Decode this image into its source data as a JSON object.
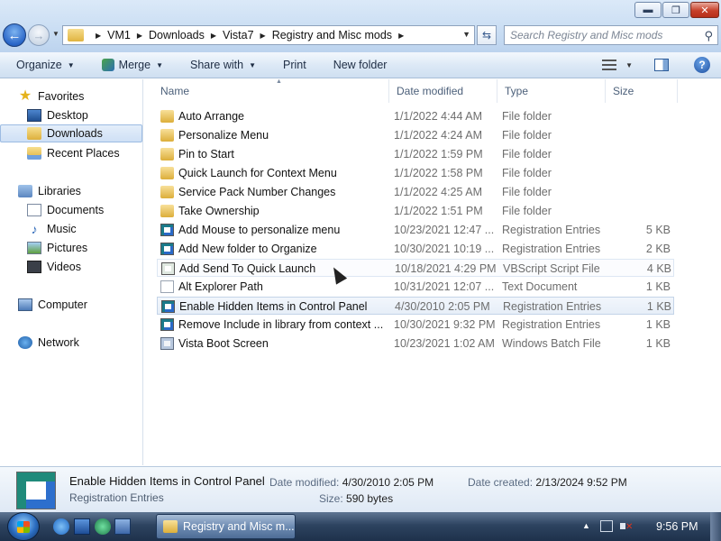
{
  "window": {
    "controls": {
      "minimize": "▬",
      "maximize": "❐",
      "close": "✕"
    },
    "address": {
      "crumbs": [
        "VM1",
        "Downloads",
        "Vista7",
        "Registry and Misc mods"
      ]
    },
    "search": {
      "placeholder": "Search Registry and Misc mods"
    }
  },
  "toolbar": {
    "organize": "Organize",
    "merge": "Merge",
    "share_with": "Share with",
    "print": "Print",
    "new_folder": "New folder"
  },
  "nav": {
    "favorites": "Favorites",
    "desktop": "Desktop",
    "downloads": "Downloads",
    "recent_places": "Recent Places",
    "libraries": "Libraries",
    "documents": "Documents",
    "music": "Music",
    "pictures": "Pictures",
    "videos": "Videos",
    "computer": "Computer",
    "network": "Network"
  },
  "columns": {
    "name": "Name",
    "date_modified": "Date modified",
    "type": "Type",
    "size": "Size"
  },
  "files": [
    {
      "name": "Auto Arrange",
      "date": "1/1/2022 4:44 AM",
      "type": "File folder",
      "size": "",
      "icon": "folder-icon"
    },
    {
      "name": "Personalize Menu",
      "date": "1/1/2022 4:24 AM",
      "type": "File folder",
      "size": "",
      "icon": "folder-icon"
    },
    {
      "name": "Pin to Start",
      "date": "1/1/2022 1:59 PM",
      "type": "File folder",
      "size": "",
      "icon": "folder-icon"
    },
    {
      "name": "Quick Launch for Context Menu",
      "date": "1/1/2022 1:58 PM",
      "type": "File folder",
      "size": "",
      "icon": "folder-icon"
    },
    {
      "name": "Service Pack Number Changes",
      "date": "1/1/2022 4:25 AM",
      "type": "File folder",
      "size": "",
      "icon": "folder-icon"
    },
    {
      "name": "Take Ownership",
      "date": "1/1/2022 1:51 PM",
      "type": "File folder",
      "size": "",
      "icon": "folder-icon"
    },
    {
      "name": "Add Mouse to personalize menu",
      "date": "10/23/2021 12:47 ...",
      "type": "Registration Entries",
      "size": "5 KB",
      "icon": "registry-file-icon"
    },
    {
      "name": "Add New folder to Organize",
      "date": "10/30/2021 10:19 ...",
      "type": "Registration Entries",
      "size": "2 KB",
      "icon": "registry-file-icon"
    },
    {
      "name": "Add Send To Quick Launch",
      "date": "10/18/2021 4:29 PM",
      "type": "VBScript Script File",
      "size": "4 KB",
      "icon": "vbscript-file-icon"
    },
    {
      "name": "Alt Explorer Path",
      "date": "10/31/2021 12:07 ...",
      "type": "Text Document",
      "size": "1 KB",
      "icon": "text-file-icon"
    },
    {
      "name": "Enable Hidden Items in Control Panel",
      "date": "4/30/2010 2:05 PM",
      "type": "Registration Entries",
      "size": "1 KB",
      "icon": "registry-file-icon"
    },
    {
      "name": "Remove Include in library from context ...",
      "date": "10/30/2021 9:32 PM",
      "type": "Registration Entries",
      "size": "1 KB",
      "icon": "registry-file-icon"
    },
    {
      "name": "Vista Boot Screen",
      "date": "10/23/2021 1:02 AM",
      "type": "Windows Batch File",
      "size": "1 KB",
      "icon": "batch-file-icon"
    }
  ],
  "details": {
    "name": "Enable Hidden Items in Control Panel",
    "type": "Registration Entries",
    "date_modified_label": "Date modified:",
    "date_modified": "4/30/2010 2:05 PM",
    "size_label": "Size:",
    "size": "590 bytes",
    "date_created_label": "Date created:",
    "date_created": "2/13/2024 9:52 PM"
  },
  "taskbar": {
    "active_window": "Registry and Misc m...",
    "clock": "9:56 PM"
  }
}
